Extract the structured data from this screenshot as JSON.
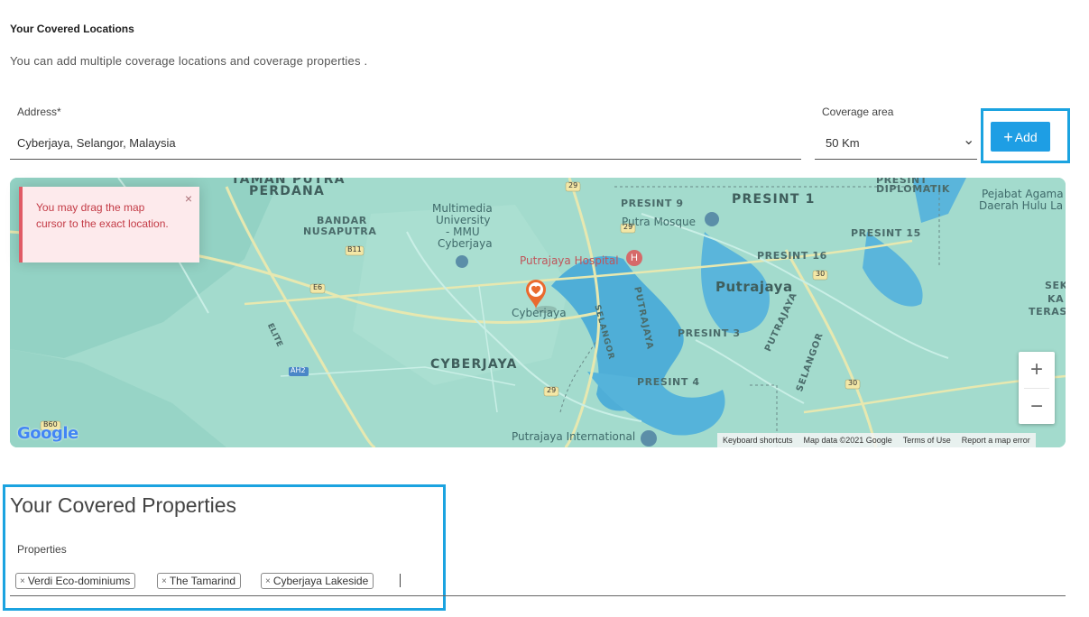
{
  "locations": {
    "title": "Your Covered Locations",
    "description": "You can add multiple coverage locations and coverage properties ."
  },
  "address": {
    "label": "Address*",
    "value": "Cyberjaya, Selangor, Malaysia"
  },
  "coverage": {
    "label": "Coverage area",
    "value": "50 Km",
    "chevron": "⌄"
  },
  "add_button": {
    "plus": "+",
    "label": "Add"
  },
  "alert": {
    "message": "You may drag the map cursor to the exact location.",
    "close": "×"
  },
  "map": {
    "labels": {
      "taman": "TAMAN PUTRA",
      "perdana": "PERDANA",
      "bandar": "BANDAR",
      "nusaputra": "NUSAPUTRA",
      "mmu1": "Multimedia",
      "mmu2": "University",
      "mmu3": "- MMU",
      "mmu4": "Cyberjaya",
      "presint9": "PRESINT 9",
      "putra_mosque": "Putra Mosque",
      "presint1": "PRESINT 1",
      "presint_diplomatik1": "PRESINT",
      "presint_diplomatik2": "DIPLOMATIK",
      "pejabat1": "Pejabat Agama I",
      "pejabat2": "Daerah Hulu La",
      "presint15": "PRESINT 15",
      "putrajaya_hospital": "Putrajaya Hospital",
      "presint16": "PRESINT 16",
      "putrajaya": "Putrajaya",
      "cyberjaya_pin": "Cyberjaya",
      "presint3": "PRESINT 3",
      "cyberjaya_area": "CYBERJAYA",
      "presint4": "PRESINT 4",
      "putrajaya_intl": "Putrajaya International",
      "selangor1": "SELANGOR",
      "putrajaya_vert": "PUTRAJAYA",
      "putrajaya_vert2": "PUTRAJAYA",
      "selangor2": "SELANGOR",
      "elite": "ELITE",
      "sek1": "SEK",
      "sek2": "KA",
      "sek3": "TERAS",
      "b11": "B11",
      "e6": "E6",
      "ah2": "AH2",
      "b60": "B60",
      "r29a": "29",
      "r29b": "29",
      "r29c": "29",
      "r30a": "30",
      "r30b": "30",
      "google": "Google"
    },
    "zoom_in": "+",
    "zoom_out": "−",
    "attribution": {
      "shortcuts": "Keyboard shortcuts",
      "data": "Map data ©2021 Google",
      "terms": "Terms of Use",
      "report": "Report a map error"
    }
  },
  "properties": {
    "title": "Your Covered Properties",
    "label": "Properties",
    "chips": [
      {
        "remove": "×",
        "label": "Verdi Eco-dominiums"
      },
      {
        "remove": "×",
        "label": "The Tamarind"
      },
      {
        "remove": "×",
        "label": "Cyberjaya Lakeside"
      }
    ]
  }
}
